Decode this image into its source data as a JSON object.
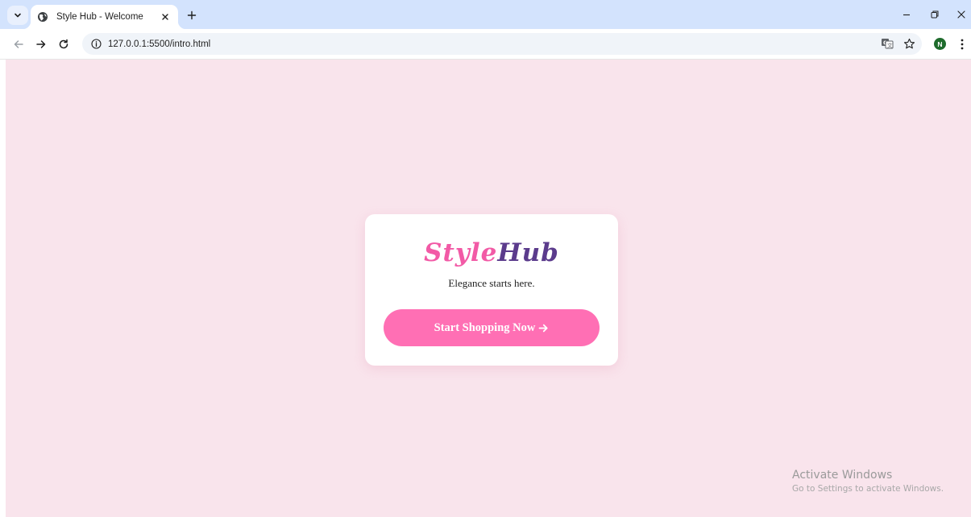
{
  "browser": {
    "tab": {
      "title": "Style Hub - Welcome"
    },
    "address_bar": {
      "url": "127.0.0.1:5500/intro.html"
    },
    "profile": {
      "initial": "N",
      "color": "#1e6b2c"
    }
  },
  "page": {
    "background": "#f9e4ec",
    "logo": {
      "part1": "Style",
      "part2": "Hub",
      "color1": "#f25aa6",
      "color2": "#5b3b8c"
    },
    "tagline": "Elegance starts here.",
    "cta": {
      "label": "Start Shopping Now",
      "color": "#ff6fb4",
      "icon": "arrow-right-icon"
    }
  },
  "watermark": {
    "title": "Activate Windows",
    "subtitle": "Go to Settings to activate Windows."
  },
  "icons": {
    "tab_search": "chevron-down-icon",
    "favicon": "globe-icon",
    "tab_close": "close-icon",
    "new_tab": "plus-icon",
    "back": "arrow-left-icon",
    "forward": "arrow-right-icon",
    "reload": "reload-icon",
    "site_info": "info-icon",
    "translate": "translate-icon",
    "bookmark": "star-icon",
    "menu": "kebab-menu-icon",
    "minimize": "minimize-icon",
    "restore": "restore-icon",
    "close_window": "close-icon"
  }
}
